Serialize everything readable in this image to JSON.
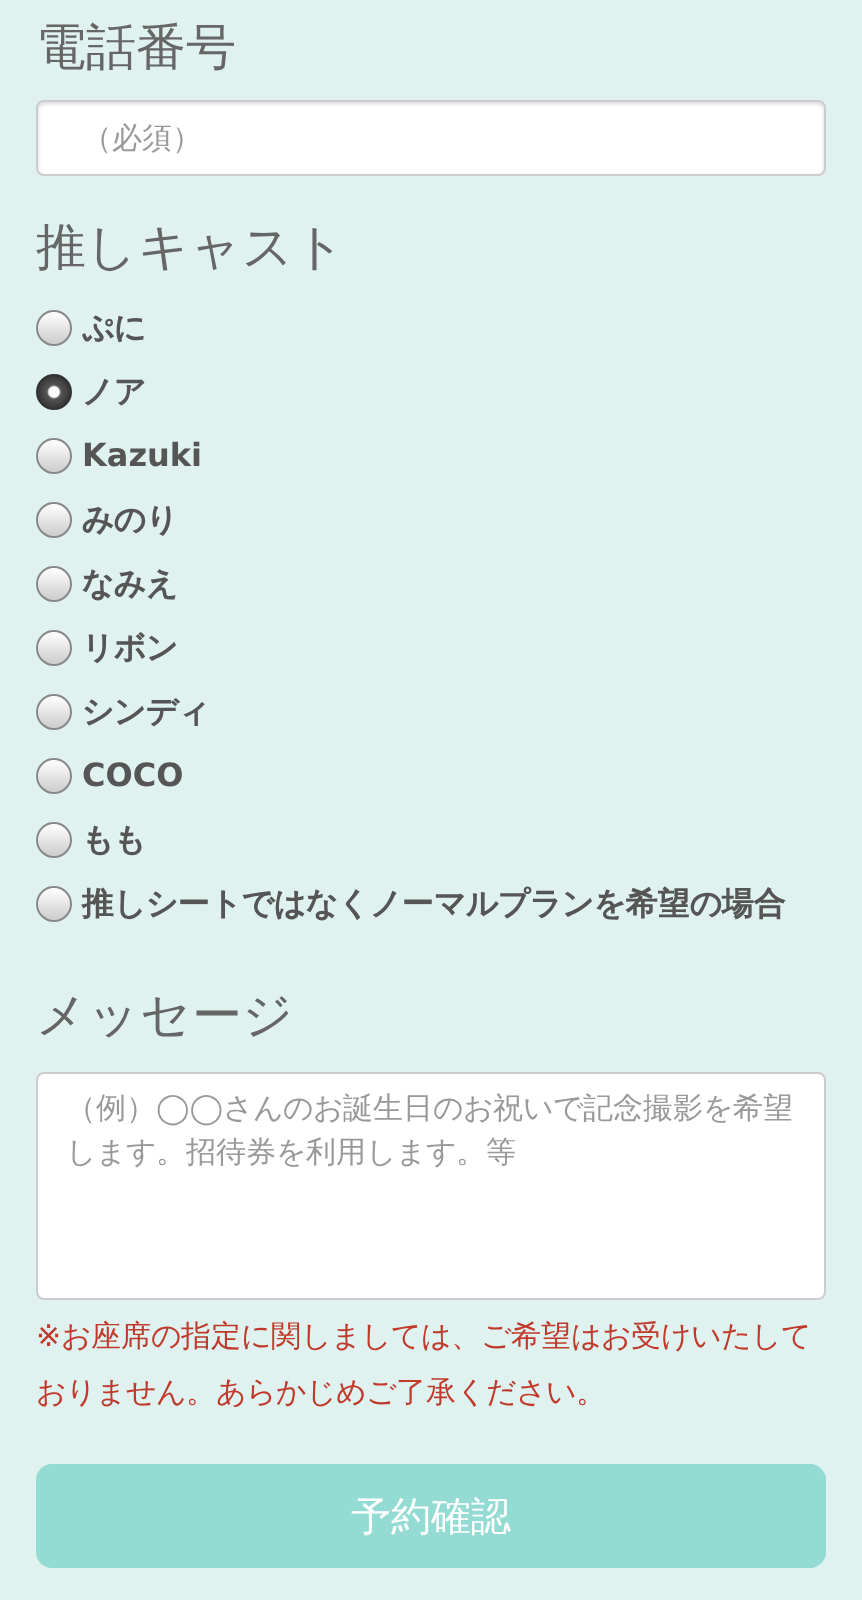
{
  "phone": {
    "label": "電話番号",
    "placeholder": "（必須）"
  },
  "cast": {
    "label": "推しキャスト",
    "options": [
      {
        "label": "ぷに",
        "selected": false
      },
      {
        "label": "ノア",
        "selected": true
      },
      {
        "label": "Kazuki",
        "selected": false
      },
      {
        "label": "みのり",
        "selected": false
      },
      {
        "label": "なみえ",
        "selected": false
      },
      {
        "label": "リボン",
        "selected": false
      },
      {
        "label": "シンディ",
        "selected": false
      },
      {
        "label": "COCO",
        "selected": false
      },
      {
        "label": "もも",
        "selected": false
      },
      {
        "label": "推しシートではなくノーマルプランを希望の場合",
        "selected": false
      }
    ]
  },
  "message": {
    "label": "メッセージ",
    "placeholder": "（例）◯◯さんのお誕生日のお祝いで記念撮影を希望します。招待券を利用します。等",
    "notice": "※お座席の指定に関しましては、ご希望はお受けいたしておりません。あらかじめご了承ください。"
  },
  "submit": {
    "label": "予約確認"
  }
}
